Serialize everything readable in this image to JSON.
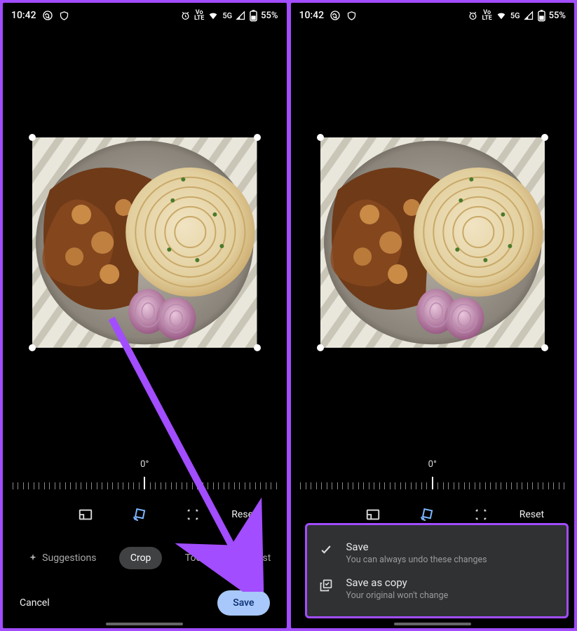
{
  "status": {
    "time": "10:42",
    "network_label": "5G",
    "battery_pct": "55%",
    "lte_top": "Vo",
    "lte_bot": "LTE"
  },
  "rotation_label": "0°",
  "reset_label": "Reset",
  "tabs": {
    "suggestions": "Suggestions",
    "crop": "Crop",
    "tools": "Tools",
    "adjust": "Adjust"
  },
  "actions": {
    "cancel": "Cancel",
    "save": "Save"
  },
  "popup": {
    "save": {
      "title": "Save",
      "sub": "You can always undo these changes"
    },
    "copy": {
      "title": "Save as copy",
      "sub": "Your original won't change"
    }
  },
  "icons": {
    "whatsapp": "whatsapp-icon",
    "shield": "shield-icon",
    "alarm": "alarm-icon",
    "wifi": "wifi-icon",
    "signal": "signal-icon",
    "battery": "battery-icon",
    "aspect": "aspect-ratio-icon",
    "rotate": "rotate-icon",
    "transform": "free-transform-icon",
    "sparkle": "sparkle-icon",
    "check": "check-icon",
    "copy": "copy-icon"
  }
}
